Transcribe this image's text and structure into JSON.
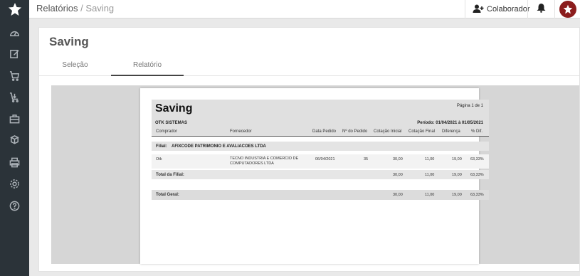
{
  "breadcrumb": {
    "section": "Relatórios",
    "separator": "/",
    "current": "Saving"
  },
  "topbar": {
    "collaborator_label": "Colaborador"
  },
  "page": {
    "title": "Saving"
  },
  "tabs": [
    {
      "label": "Seleção"
    },
    {
      "label": "Relatório"
    }
  ],
  "report": {
    "title": "Saving",
    "page_info": "Página 1 de 1",
    "company": "OTK SISTEMAS",
    "period": "Período: 01/04/2021 à 01/05/2021",
    "columns": [
      "Comprador",
      "Fornecedor",
      "Data Pedido",
      "Nº do Pedido",
      "Cotação Inicial",
      "Cotação Final",
      "Diferença",
      "% Dif."
    ],
    "branch": {
      "label": "Filial:",
      "name": "AFIXCODE PATRIMONIO E AVALIACOES LTDA"
    },
    "row": {
      "buyer": "Otk",
      "supplier": "TECNO INDUSTRIA E COMERCIO DE COMPUTADORES LTDA",
      "date": "06/04/2021",
      "order": "35",
      "initial": "30,00",
      "final": "11,00",
      "difference": "19,00",
      "percent": "63,33%"
    },
    "branch_total": {
      "label": "Total da Filial:",
      "initial": "30,00",
      "final": "11,00",
      "difference": "19,00",
      "percent": "63,33%"
    },
    "general_total": {
      "label": "Total Geral:",
      "initial": "30,00",
      "final": "11,00",
      "difference": "19,00",
      "percent": "63,33%"
    }
  },
  "icons": [
    "dashboard-icon",
    "edit-icon",
    "cart-icon",
    "cart-arrow-icon",
    "briefcase-icon",
    "cubes-icon",
    "printer-icon",
    "gear-icon",
    "help-icon",
    "add-user-icon",
    "bell-icon"
  ],
  "colors": {
    "sidebar": "#2b3339",
    "avatar": "#8b1c1c"
  }
}
